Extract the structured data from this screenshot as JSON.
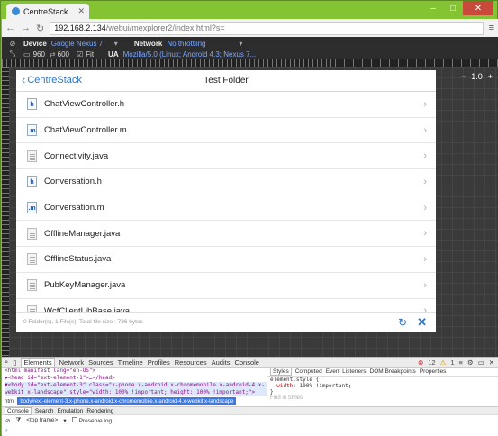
{
  "browser": {
    "tab_title": "CentreStack",
    "url_host": "192.168.2.134",
    "url_path": "/webui/mexplorer2/index.html?s="
  },
  "emulation": {
    "device_label": "Device",
    "device_value": "Google Nexus 7",
    "network_label": "Network",
    "network_value": "No throttling",
    "width": "960",
    "height": "600",
    "fit_label": "Fit",
    "ua_label": "UA",
    "ua_value": "Mozilla/5.0 (Linux; Android 4.3; Nexus 7..."
  },
  "zoom": {
    "value": "1.0"
  },
  "app": {
    "back_label": "CentreStack",
    "title": "Test Folder",
    "files": [
      {
        "name": "ChatViewController.h",
        "type": "h"
      },
      {
        "name": "ChatViewController.m",
        "type": "m"
      },
      {
        "name": "Connectivity.java",
        "type": "java"
      },
      {
        "name": "Conversation.h",
        "type": "h"
      },
      {
        "name": "Conversation.m",
        "type": "m"
      },
      {
        "name": "OfflineManager.java",
        "type": "java"
      },
      {
        "name": "OfflineStatus.java",
        "type": "java"
      },
      {
        "name": "PubKeyManager.java",
        "type": "java"
      },
      {
        "name": "WcfClientLibBase.java",
        "type": "java"
      }
    ],
    "footer_text": "0 Folder(s), 1 File(s), Total file size : 736 bytes"
  },
  "devtools": {
    "tabs": [
      "Elements",
      "Network",
      "Sources",
      "Timeline",
      "Profiles",
      "Resources",
      "Audits",
      "Console"
    ],
    "error_count": "12",
    "warn_count": "1",
    "dom_lines": [
      "<html manifest lang=\"en-US\">",
      "▶<head id=\"ext-element-1\">…</head>",
      "▼<body id=\"ext-element-3\" class=\"x-phone x-android x-chromemobile x-android-4 x-",
      "webkit x-landscape\" style=\"width: 100% !important; height: 100% !important;\">"
    ],
    "side_tabs": [
      "Styles",
      "Computed",
      "Event Listeners",
      "DOM Breakpoints",
      "Properties"
    ],
    "style_selector": "element.style {",
    "style_prop": "width",
    "style_value": "100% !important;",
    "style_close": "}",
    "find_placeholder": "Find in Styles",
    "breadcrumb_html": "html",
    "breadcrumb_body": "body#ext-element-3.x-phone.x-android.x-chromemobile.x-android-4.x-webkit.x-landscape",
    "console_tabs": [
      "Console",
      "Search",
      "Emulation",
      "Rendering"
    ],
    "frame_select": "<top frame>",
    "preserve_log": "Preserve log"
  }
}
